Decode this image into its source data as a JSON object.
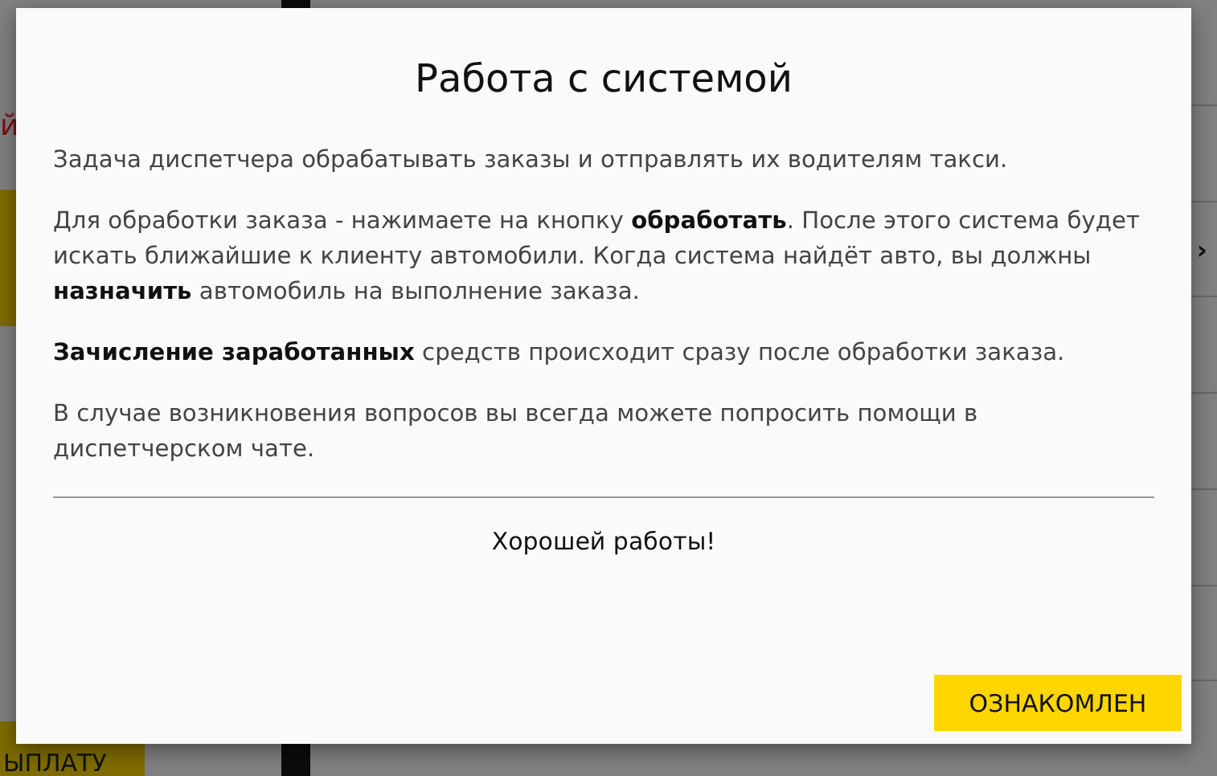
{
  "background": {
    "left_fragments": [
      {
        "text": "й",
        "kind": "red"
      },
      {
        "kind": "yellow"
      },
      {
        "text": "ЫПЛАТУ",
        "kind": "button"
      }
    ],
    "row_arrow": "›"
  },
  "dialog": {
    "title": "Работа с системой",
    "paragraphs": [
      "Задача диспетчера обрабатывать заказы и отправлять их водителям такси.",
      "Для обработки заказа - нажимаете на кнопку **обработать**. После этого система будет искать ближайшие к клиенту автомобили. Когда система найдёт авто, вы должны **назначить** автомобиль на выполнение заказа.",
      "**Зачисление заработанных** средств происходит сразу после обработки заказа.",
      "В случае возникновения вопросов вы всегда можете попросить помощи в диспетчерском чате."
    ],
    "closing": "Хорошей работы!",
    "button": "ОЗНАКОМЛЕН"
  }
}
